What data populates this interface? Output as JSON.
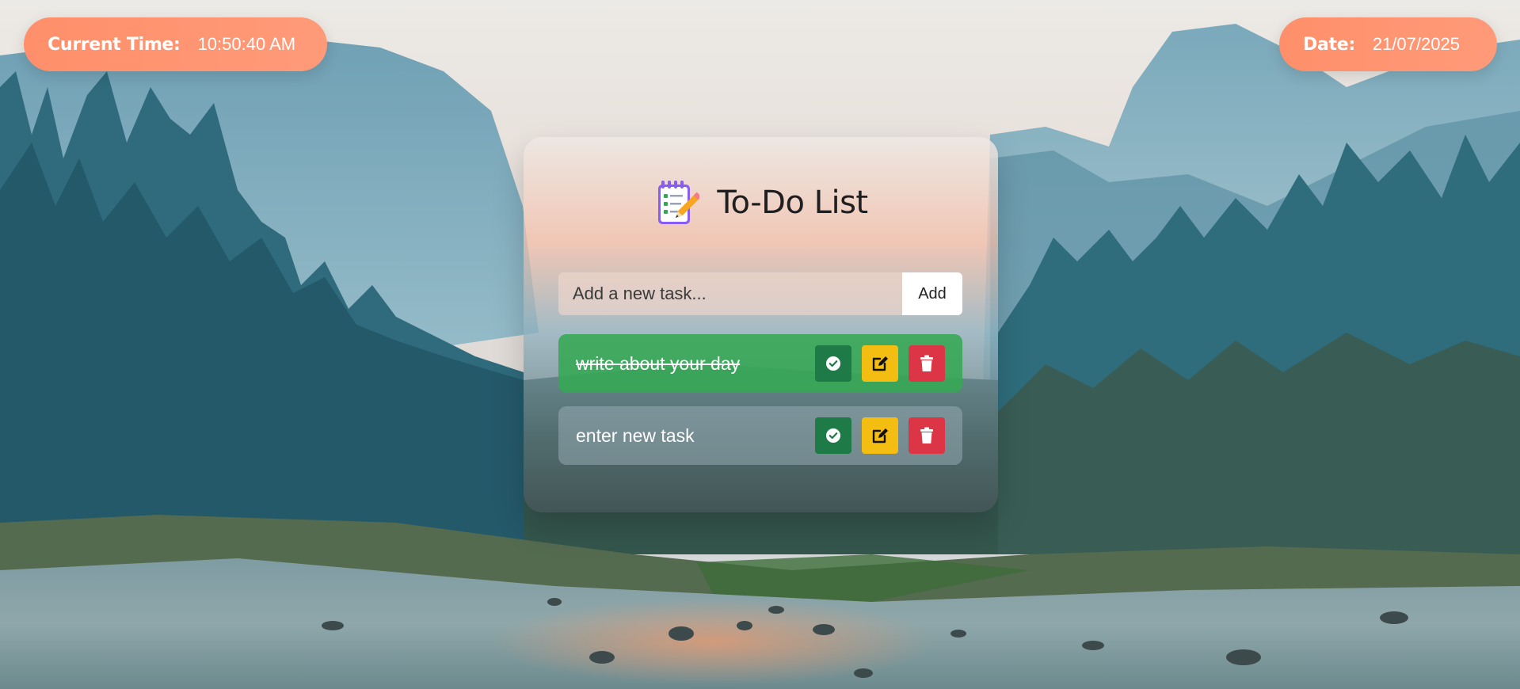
{
  "clock": {
    "label": "Current Time:",
    "value": "10:50:40 AM"
  },
  "date": {
    "label": "Date:",
    "value": "21/07/2025"
  },
  "app": {
    "icon": "notepad-icon",
    "title": "To-Do List"
  },
  "new_task": {
    "placeholder": "Add a new task...",
    "value": "",
    "add_label": "Add"
  },
  "tasks": [
    {
      "text": "write about your day",
      "completed": true
    },
    {
      "text": "enter new task",
      "completed": false
    }
  ],
  "colors": {
    "pill": "#ff8f6b",
    "completed_task": "#34a853",
    "complete_button": "#1e7a47",
    "edit_button": "#f4bd12",
    "delete_button": "#dc3545"
  },
  "icons": {
    "complete": "check-circle-icon",
    "edit": "edit-icon",
    "delete": "trash-icon"
  }
}
